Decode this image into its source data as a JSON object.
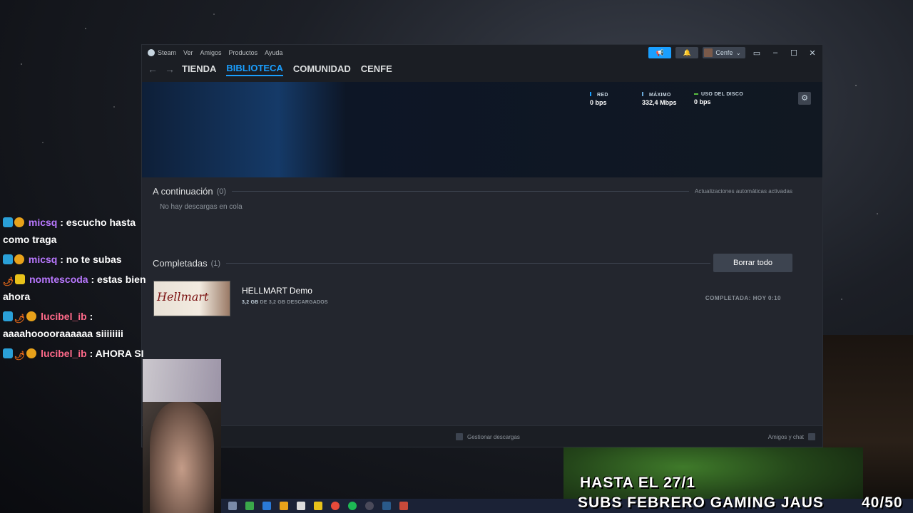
{
  "steam": {
    "menu": [
      "Steam",
      "Ver",
      "Amigos",
      "Productos",
      "Ayuda"
    ],
    "user_name": "Cenfe",
    "nav_tabs": [
      "TIENDA",
      "BIBLIOTECA",
      "COMUNIDAD",
      "CENFE"
    ],
    "active_tab": "BIBLIOTECA",
    "stats": {
      "red_label": "RED",
      "red_value": "0 bps",
      "max_label": "MÁXIMO",
      "max_value": "332,4 Mbps",
      "disk_label": "USO DEL DISCO",
      "disk_value": "0 bps"
    },
    "queue": {
      "title": "A continuación",
      "count": "(0)",
      "auto_updates": "Actualizaciones automáticas activadas",
      "empty": "No hay descargas en cola"
    },
    "completed": {
      "title": "Completadas",
      "count": "(1)",
      "clear_button": "Borrar todo",
      "game": {
        "name": "HELLMART Demo",
        "thumb_text": "Hellmart",
        "downloaded": "3,2 GB",
        "size_rest": "DE 3,2 GB DESCARGADOS",
        "status": "COMPLETADA: HOY 0:10"
      }
    },
    "footer": {
      "manage": "Gestionar descargas",
      "friends": "Amigos y chat"
    }
  },
  "chat": [
    {
      "user": "micsq",
      "text": ": escucho hasta como traga",
      "color": "purple"
    },
    {
      "user": "micsq",
      "text": ": no te subas",
      "color": "purple"
    },
    {
      "user": "nomtescoda",
      "text": ": estas bien ahora",
      "color": "purple"
    },
    {
      "user": "lucibel_ib",
      "text": ": aaaahooooraaaaaa siiiiiiii",
      "color": "pink"
    },
    {
      "user": "lucibel_ib",
      "text": ": AHORA SI",
      "color": "pink"
    }
  ],
  "overlay": {
    "line1": "HASTA EL 27/1",
    "line2": "SUBS FEBRERO GAMING JAUS",
    "counter": "40/50"
  },
  "colors": {
    "accent": "#1a9fff",
    "bg": "#1b1e24",
    "panel": "#23262e"
  }
}
